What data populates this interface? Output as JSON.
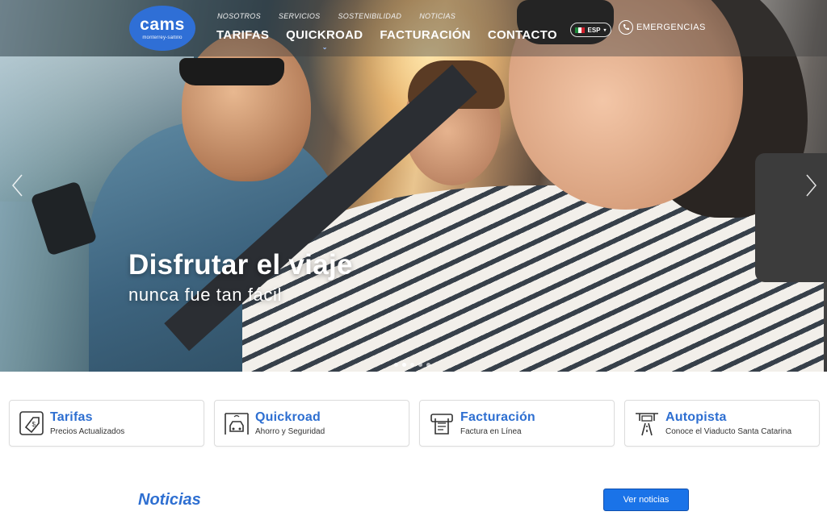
{
  "brand": {
    "logo_main": "cams",
    "logo_sub": "monterrey-saltillo"
  },
  "nav": {
    "secondary": [
      "NOSOTROS",
      "SERVICIOS",
      "SOSTENIBILIDAD",
      "NOTICIAS"
    ],
    "primary": [
      "TARIFAS",
      "QUICKROAD",
      "FACTURACIÓN",
      "CONTACTO"
    ],
    "language": "ESP",
    "emergency": "EMERGENCIAS"
  },
  "hero": {
    "title": "Disfrutar el viaje",
    "subtitle": "nunca fue tan fácil",
    "slide_count": 5,
    "active_slide": 1
  },
  "cards": [
    {
      "title": "Tarifas",
      "desc": "Precios Actualizados",
      "icon": "price-tag-icon"
    },
    {
      "title": "Quickroad",
      "desc": "Ahorro y Seguridad",
      "icon": "toll-booth-car-icon"
    },
    {
      "title": "Facturación",
      "desc": "Factura en Línea",
      "icon": "invoice-printer-icon"
    },
    {
      "title": "Autopista",
      "desc": "Conoce el Viaducto Santa Catarina",
      "icon": "highway-road-icon"
    }
  ],
  "news": {
    "title": "Noticias",
    "button": "Ver noticias"
  },
  "colors": {
    "accent": "#2e6fd1",
    "button": "#1a73e8",
    "logo": "#2f6fd6"
  }
}
